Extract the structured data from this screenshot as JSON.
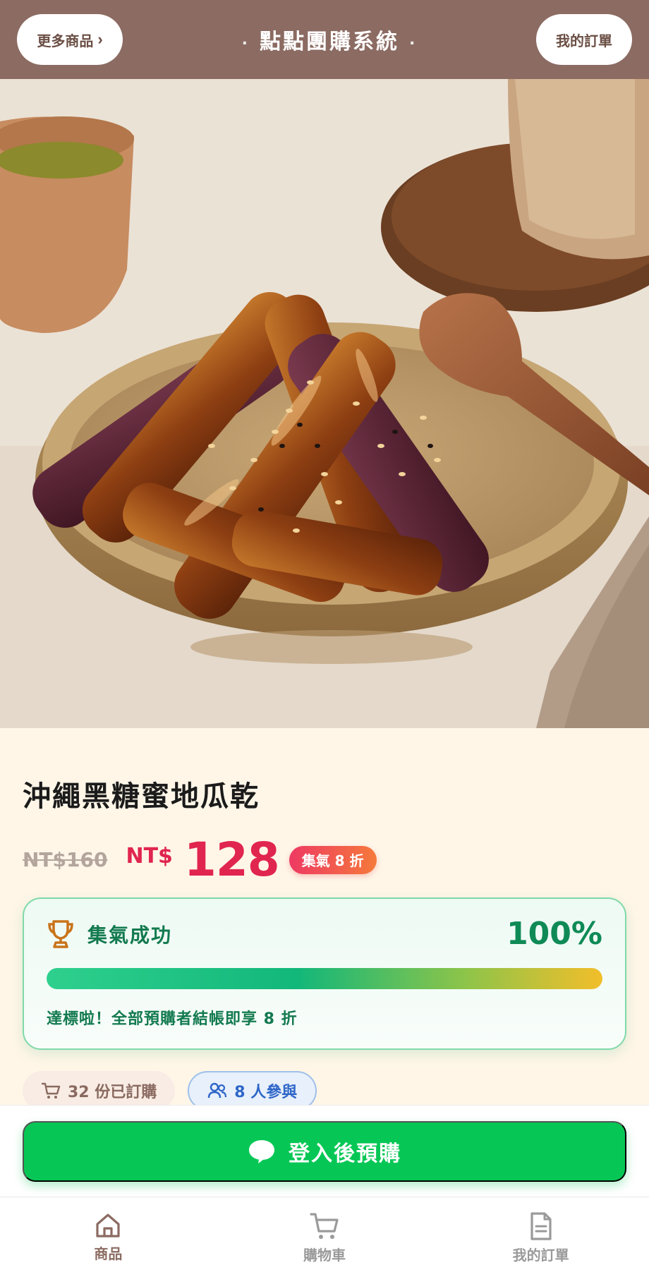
{
  "header": {
    "more_products": "更多商品",
    "title": "點點團購系統",
    "my_orders": "我的訂單"
  },
  "hero": {
    "image": "glazed-sweet-potato-photo"
  },
  "product": {
    "name": "沖繩黑糖蜜地瓜乾",
    "original_price": "NT$160",
    "currency": "NT$",
    "price": "128",
    "discount_badge": "集氣 8 折"
  },
  "progress": {
    "label": "集氣成功",
    "percent_text": "100%",
    "percent": 100,
    "message": "達標啦！全部預購者結帳即享 8 折"
  },
  "stats": {
    "ordered": "32 份已訂購",
    "participants": "8 人參與"
  },
  "cta": {
    "label": "登入後預購"
  },
  "tabbar": {
    "items": [
      {
        "label": "商品",
        "icon": "home-icon",
        "active": true
      },
      {
        "label": "購物車",
        "icon": "cart-icon",
        "active": false
      },
      {
        "label": "我的訂單",
        "icon": "document-icon",
        "active": false
      }
    ]
  },
  "colors": {
    "header_bg": "#8b6b62",
    "price_red": "#e0254f",
    "success_green": "#0f8a56",
    "cta_green": "#06c755",
    "people_blue": "#2f66c8"
  }
}
